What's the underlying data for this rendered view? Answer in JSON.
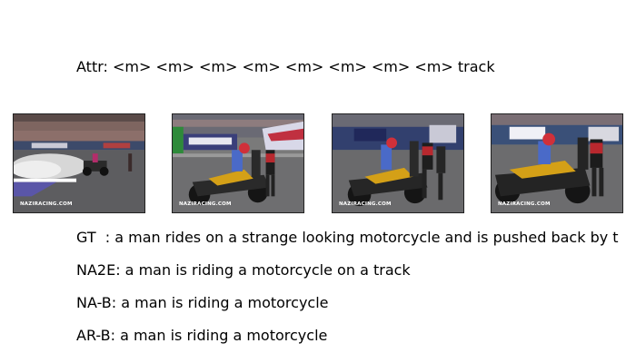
{
  "attr_text": "Attr: <m> <m> <m> <m> <m> <m> <m> <m> track",
  "frames": [
    {
      "watermark": "NAZIRACING.COM"
    },
    {
      "watermark": "NAZIRACING.COM"
    },
    {
      "watermark": "NAZIRACING.COM"
    },
    {
      "watermark": "NAZIRACING.COM"
    }
  ],
  "captions": {
    "gt": "GT  : a man rides on a strange looking motorcycle and is pushed back by t",
    "na2e": "NA2E: a man is riding a motorcycle on a track",
    "na_b": "NA-B: a man is riding a motorcycle",
    "ar_b": "AR-B: a man is riding a motorcycle"
  }
}
